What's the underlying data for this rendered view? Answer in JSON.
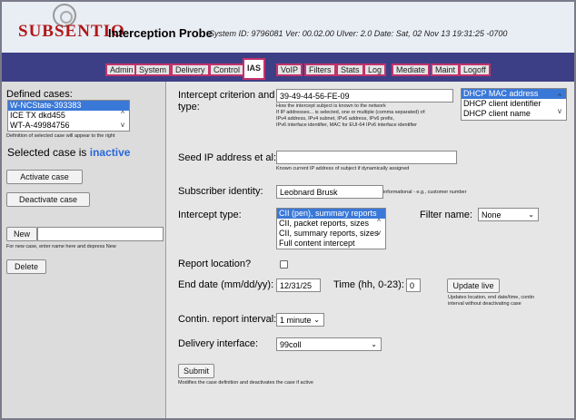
{
  "header": {
    "logo_text": "SUBSENTIO",
    "title": "Interception Probe",
    "info": "System ID: 9796081   Ver: 00.02.00   UIver: 2.0   Date: Sat, 02 Nov 13 19:31:25 -0700"
  },
  "tabs": [
    {
      "label": "Admin"
    },
    {
      "label": "System"
    },
    {
      "label": "Delivery"
    },
    {
      "label": "Control"
    },
    {
      "label": "IAS"
    },
    {
      "label": "VoIP"
    },
    {
      "label": "Filters"
    },
    {
      "label": "Stats"
    },
    {
      "label": "Log"
    },
    {
      "label": "Mediate"
    },
    {
      "label": "Maint"
    },
    {
      "label": "Logoff"
    }
  ],
  "active_tab": "IAS",
  "left": {
    "defined_cases_label": "Defined cases:",
    "cases": [
      "W-NCState-393383",
      "ICE TX dkd455",
      "WT-A-49984756"
    ],
    "selected_case": "W-NCState-393383",
    "cases_hint": "Definition of selected case will appear to the right",
    "status_prefix": "Selected case is",
    "status_value": "inactive",
    "activate_label": "Activate case",
    "deactivate_label": "Deactivate case",
    "new_label": "New",
    "new_input_value": "",
    "new_hint": "For new case, enter name here and depress New",
    "delete_label": "Delete"
  },
  "right": {
    "criterion_label": "Intercept criterion and type:",
    "criterion_value": "39-49-44-56-FE-09",
    "criterion_hint_1": "How the intercept subject is known to the network",
    "criterion_hint_2": "If IP addresses... is selected, one or multiple (comma separated) of:",
    "criterion_hint_3": "IPv4 address, IPv4 subnet, IPv6 address, IPv6 prefix,",
    "criterion_hint_4": "IPv6 interface identifier, MAC for EUI-64 IPv6 interface identifier",
    "criterion_types": [
      "DHCP MAC address",
      "DHCP client identifier",
      "DHCP client name"
    ],
    "criterion_type_selected": "DHCP MAC address",
    "seed_label": "Seed IP address et al:",
    "seed_value": "",
    "seed_hint": "Known current IP address of subject if dynamically assigned",
    "subscriber_label": "Subscriber identity:",
    "subscriber_value": "Leobnard Brusk",
    "subscriber_hint": "informational - e.g., customer number",
    "intercept_type_label": "Intercept type:",
    "intercept_types": [
      "CII (pen), summary reports",
      "CII, packet reports, sizes",
      "CII, summary reports, sizes",
      "Full content intercept"
    ],
    "intercept_type_selected": "CII (pen), summary reports",
    "filter_label": "Filter name:",
    "filter_value": "None",
    "report_location_label": "Report location?",
    "report_location_checked": false,
    "end_date_label": "End date (mm/dd/yy):",
    "end_date_value": "12/31/25",
    "time_label": "Time (hh, 0-23):",
    "time_value": "0",
    "update_live_label": "Update live",
    "update_live_hint_1": "Updates location, end date/time, contin",
    "update_live_hint_2": "interval without deactivating case",
    "contin_label": "Contin. report interval:",
    "contin_value": "1 minute",
    "delivery_label": "Delivery interface:",
    "delivery_value": "99coll",
    "submit_label": "Submit",
    "submit_hint": "Modifies the case definition and deactivates the case if active"
  },
  "colors": {
    "tabbar": "#3d3f86",
    "tab_border": "#c3336c",
    "selection": "#3a78d8",
    "status_inactive": "#2a68d8"
  }
}
